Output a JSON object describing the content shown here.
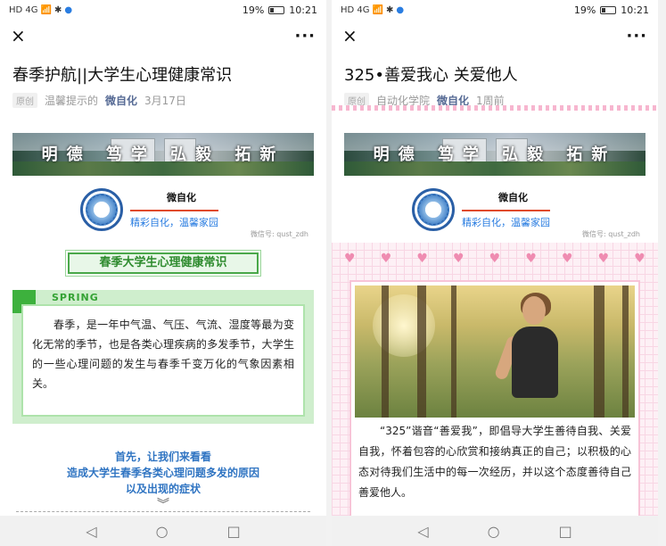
{
  "status": {
    "signal": "HD 4G",
    "battery": "19%",
    "time": "10:21"
  },
  "nav": {
    "close": "×",
    "more": "···",
    "back": "◁",
    "home": "○",
    "recent": "□"
  },
  "left": {
    "title": "春季护航||大学生心理健康常识",
    "meta": {
      "tag": "原创",
      "author": "温馨提示的",
      "account": "微自化",
      "date": "3月17日"
    },
    "banner_motto": "明德 笃学 弘毅 拓新",
    "logo": {
      "name": "微自化",
      "slogan": "精彩自化，温馨家园",
      "wx_id": "微信号: qust_zdh"
    },
    "heading": "春季大学生心理健康常识",
    "spring_label": "SPRING",
    "spring_text": "春季，是一年中气温、气压、气流、湿度等最为变化无常的季节，也是各类心理疾病的多发季节，大学生的一些心理问题的发生与春季千变万化的气象因素相关。",
    "intro": [
      "首先，让我们来看看",
      "造成大学生春季各类心理问题多发的原因",
      "以及出现的症状"
    ],
    "chevron": "︾"
  },
  "right": {
    "title": "325•善爱我心 关爱他人",
    "meta": {
      "tag": "原创",
      "author": "自动化学院",
      "account": "微自化",
      "date": "1周前"
    },
    "banner_motto": "明德 笃学 弘毅 拓新",
    "logo": {
      "name": "微自化",
      "slogan": "精彩自化，温馨家园",
      "wx_id": "微信号: qust_zdh"
    },
    "hearts": [
      "♥",
      "♥",
      "♥",
      "♥",
      "♥",
      "♥",
      "♥",
      "♥",
      "♥"
    ],
    "body_text": "“325”谐音“善爱我”，即倡导大学生善待自我、关爱自我，怀着包容的心欣赏和接纳真正的自己；以积极的心态对待我们生活中的每一次经历，并以这个态度善待自己善爱他人。"
  },
  "colors": {
    "account": "#576b95",
    "green": "#3db13d",
    "pink": "#f7c4d7",
    "intro_blue": "#2f74c2"
  }
}
